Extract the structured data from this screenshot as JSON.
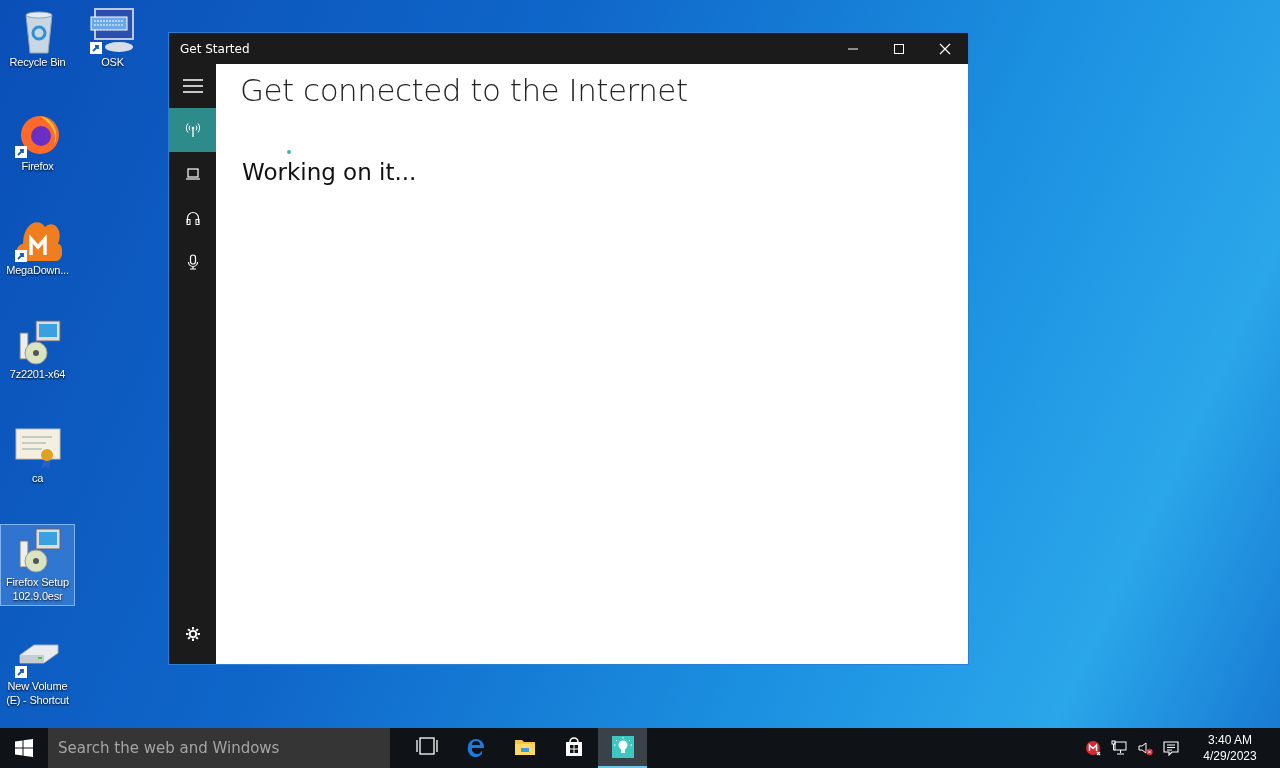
{
  "desktop": {
    "icon_rows": [
      [
        {
          "label": "Recycle Bin",
          "kind": "recycle-bin",
          "shortcut": false,
          "selected": false
        },
        {
          "label": "OSK",
          "kind": "keyboard",
          "shortcut": true,
          "selected": false
        }
      ],
      [
        {
          "label": "Firefox",
          "kind": "firefox",
          "shortcut": true,
          "selected": false
        }
      ],
      [
        {
          "label": "MegaDown...",
          "kind": "cloud",
          "shortcut": true,
          "selected": false
        }
      ],
      [
        {
          "label": "7z2201-x64",
          "kind": "installer",
          "shortcut": false,
          "selected": false
        }
      ],
      [
        {
          "label": "ca",
          "kind": "certificate",
          "shortcut": false,
          "selected": false
        }
      ],
      [
        {
          "label": "Firefox Setup 102.9.0esr",
          "kind": "installer",
          "shortcut": false,
          "selected": true
        }
      ],
      [
        {
          "label": "New Volume (E) - Shortcut",
          "kind": "drive",
          "shortcut": true,
          "selected": false
        }
      ]
    ]
  },
  "window": {
    "title": "Get Started",
    "sidebar": {
      "items": [
        {
          "kind": "wireless",
          "selected": true
        },
        {
          "kind": "laptop",
          "selected": false
        },
        {
          "kind": "headphones",
          "selected": false
        },
        {
          "kind": "microphone",
          "selected": false
        }
      ]
    },
    "heading": "Get connected to the Internet",
    "status": "Working on it..."
  },
  "taskbar": {
    "search": {
      "placeholder": "Search the web and Windows"
    },
    "apps": [
      {
        "kind": "task-view",
        "active": false
      },
      {
        "kind": "edge",
        "active": false
      },
      {
        "kind": "explorer",
        "active": false
      },
      {
        "kind": "store",
        "active": false
      },
      {
        "kind": "get-started",
        "active": true
      }
    ],
    "tray": [
      {
        "kind": "mega"
      },
      {
        "kind": "network"
      },
      {
        "kind": "volume-muted"
      },
      {
        "kind": "action-center"
      }
    ],
    "time": "3:40 AM",
    "date": "4/29/2023"
  }
}
